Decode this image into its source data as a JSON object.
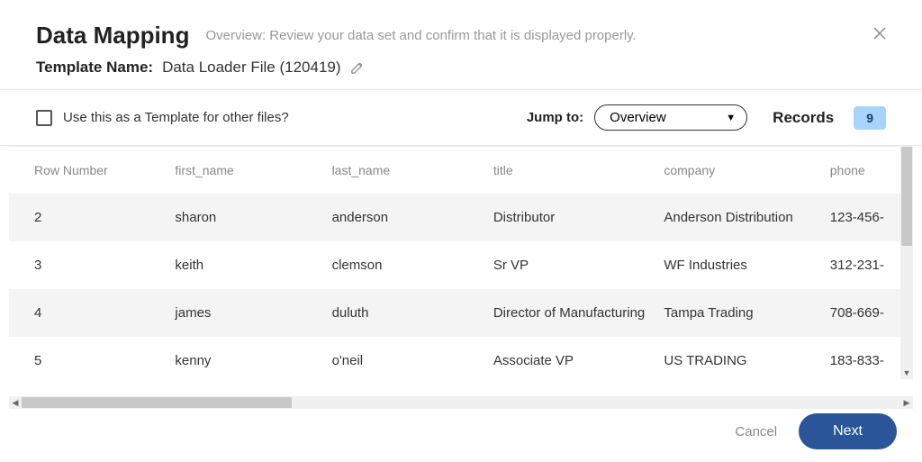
{
  "header": {
    "title": "Data Mapping",
    "subtitle": "Overview: Review your data set and confirm that it is displayed properly.",
    "template_label": "Template Name:",
    "template_value": "Data Loader File (120419)"
  },
  "toolbar": {
    "checkbox_label": "Use this as a Template for other files?",
    "jumpto_label": "Jump to:",
    "jumpto_value": "Overview",
    "records_label": "Records",
    "records_count": "9"
  },
  "table": {
    "headers": {
      "row_number": "Row Number",
      "first_name": "first_name",
      "last_name": "last_name",
      "title": "title",
      "company": "company",
      "phone": "phone"
    },
    "rows": [
      {
        "row_number": "2",
        "first_name": "sharon",
        "last_name": "anderson",
        "title": "Distributor",
        "company": "Anderson Distribution",
        "phone": "123-456-"
      },
      {
        "row_number": "3",
        "first_name": "keith",
        "last_name": "clemson",
        "title": "Sr VP",
        "company": "WF Industries",
        "phone": "312-231-"
      },
      {
        "row_number": "4",
        "first_name": "james",
        "last_name": "duluth",
        "title": "Director of Manufacturing",
        "company": "Tampa Trading",
        "phone": "708-669-"
      },
      {
        "row_number": "5",
        "first_name": "kenny",
        "last_name": "o'neil",
        "title": "Associate VP",
        "company": "US TRADING",
        "phone": "183-833-"
      }
    ]
  },
  "footer": {
    "cancel": "Cancel",
    "next": "Next"
  }
}
